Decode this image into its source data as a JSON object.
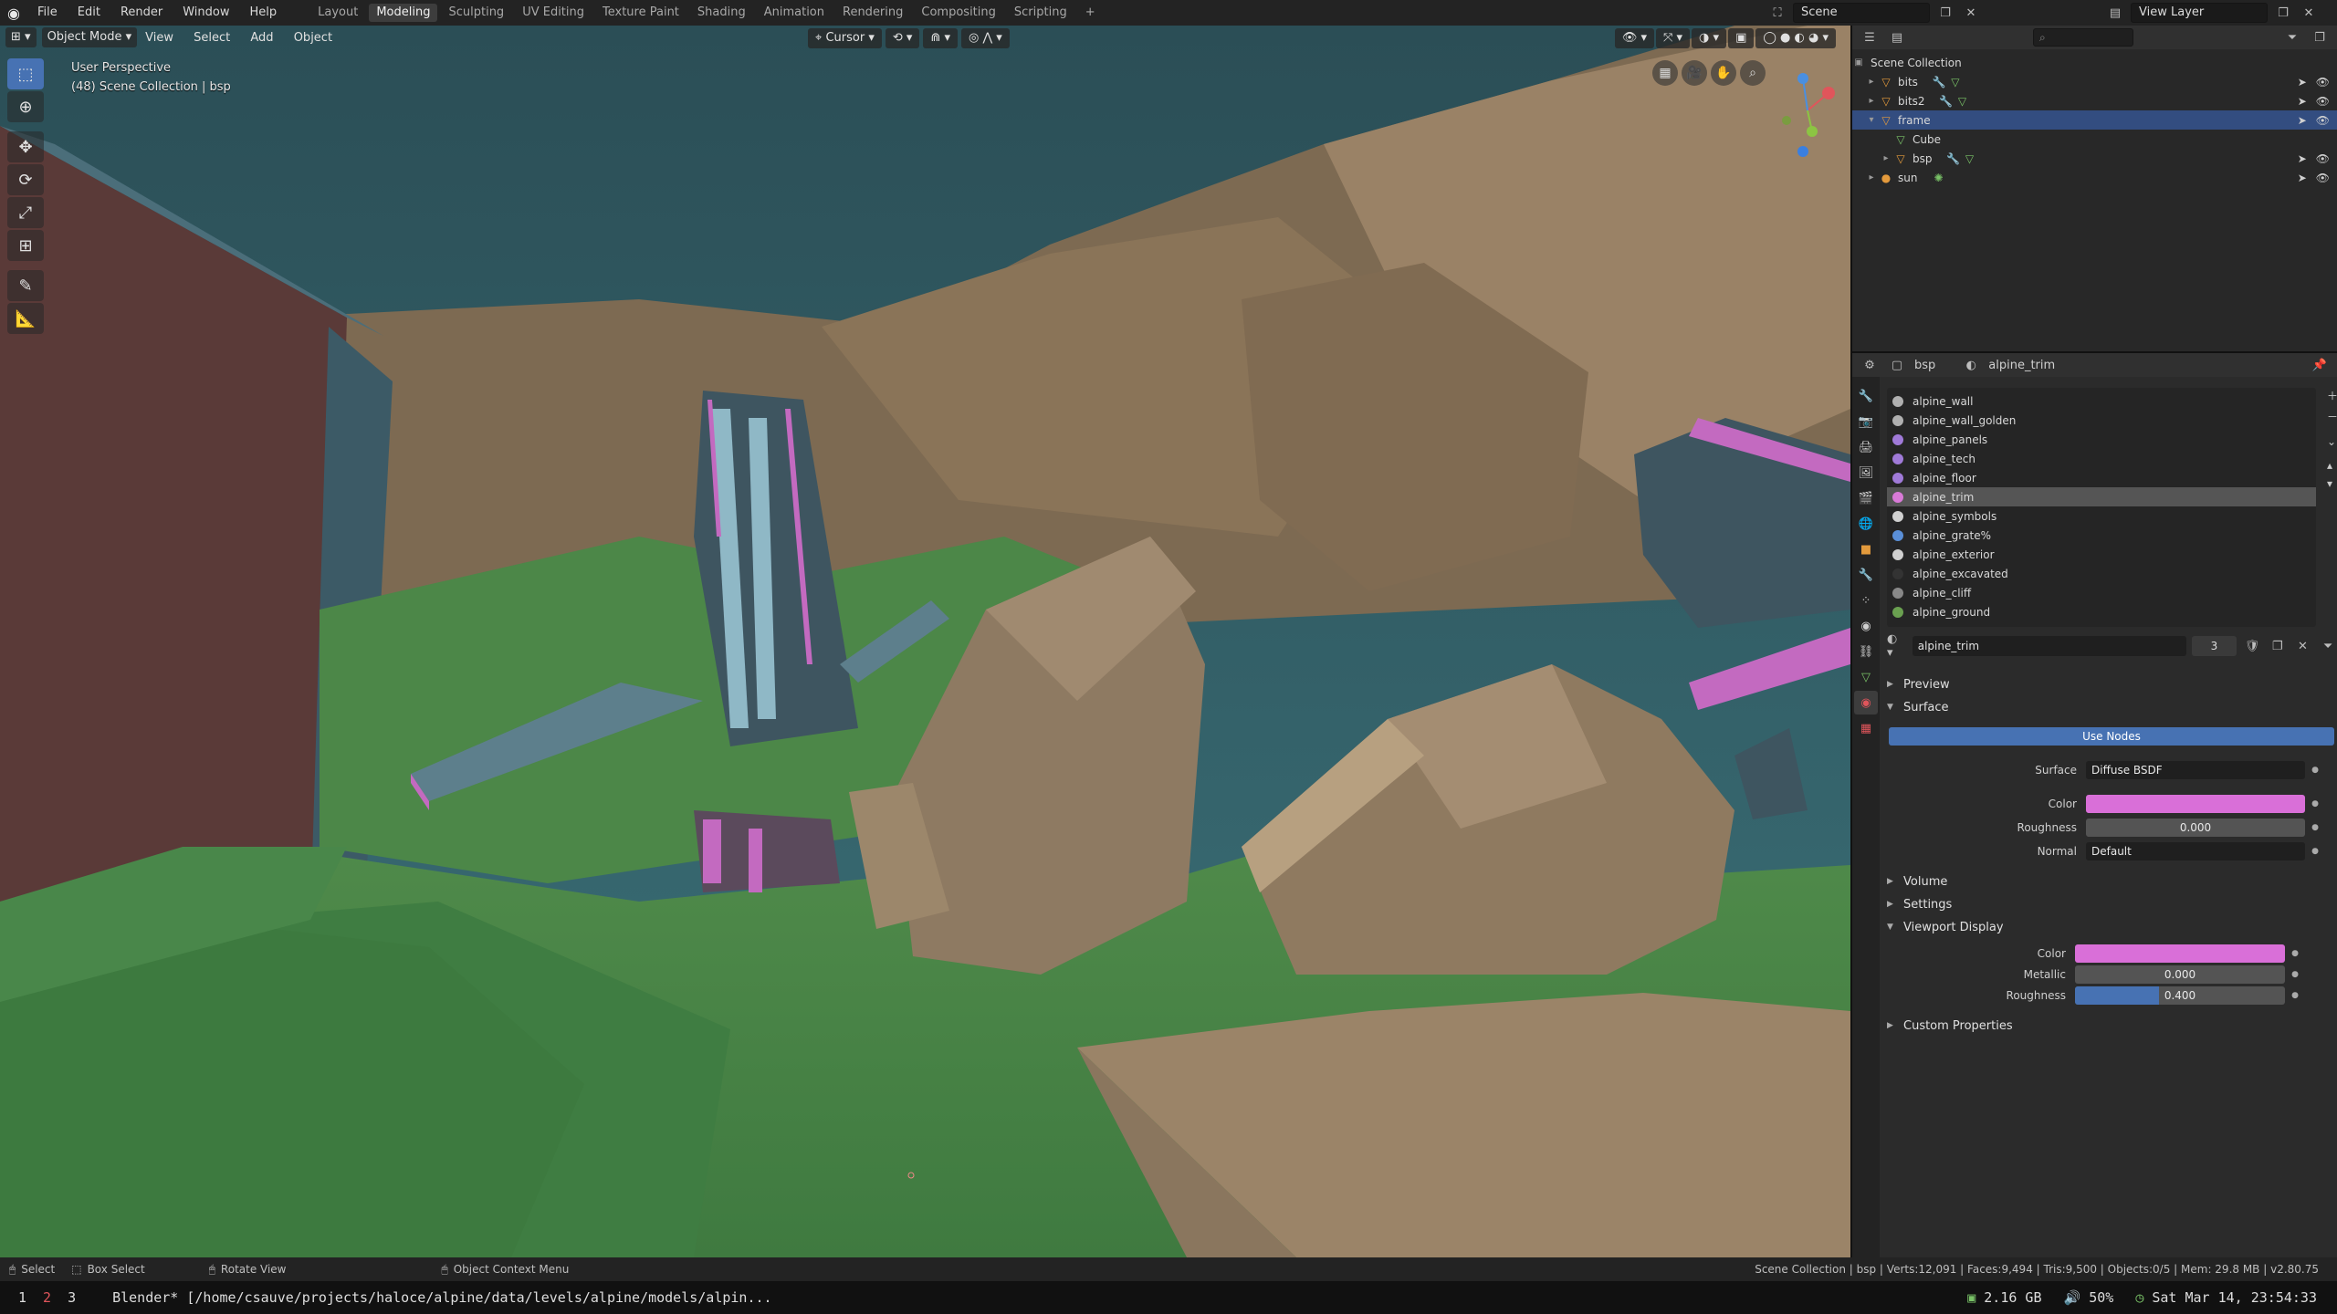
{
  "topbar": {
    "menus": [
      "File",
      "Edit",
      "Render",
      "Window",
      "Help"
    ],
    "workspaces": [
      "Layout",
      "Modeling",
      "Sculpting",
      "UV Editing",
      "Texture Paint",
      "Shading",
      "Animation",
      "Rendering",
      "Compositing",
      "Scripting"
    ],
    "active_workspace": "Modeling",
    "add_tab": "+",
    "scene": "Scene",
    "view_layer": "View Layer"
  },
  "viewport": {
    "mode": "Object Mode",
    "menus": [
      "View",
      "Select",
      "Add",
      "Object"
    ],
    "transform_orientation": "Cursor",
    "overlay_title": "User Perspective",
    "overlay_collection": "(48) Scene Collection | bsp"
  },
  "outliner": {
    "root": "Scene Collection",
    "items": [
      {
        "name": "bits",
        "selected": false
      },
      {
        "name": "bits2",
        "selected": false
      },
      {
        "name": "frame",
        "selected": true
      },
      {
        "name": "Cube",
        "selected": false
      },
      {
        "name": "bsp",
        "selected": false
      },
      {
        "name": "sun",
        "selected": false
      }
    ]
  },
  "properties": {
    "object": "bsp",
    "material": "alpine_trim",
    "materials": [
      {
        "name": "alpine_wall",
        "color": "#b0b0b0"
      },
      {
        "name": "alpine_wall_golden",
        "color": "#b0b0b0"
      },
      {
        "name": "alpine_panels",
        "color": "#a07ad8"
      },
      {
        "name": "alpine_tech",
        "color": "#a07ad8"
      },
      {
        "name": "alpine_floor",
        "color": "#a07ad8"
      },
      {
        "name": "alpine_trim",
        "color": "#d97ad8"
      },
      {
        "name": "alpine_symbols",
        "color": "#d0d0d0"
      },
      {
        "name": "alpine_grate%",
        "color": "#5a8fd8"
      },
      {
        "name": "alpine_exterior",
        "color": "#d0d0d0"
      },
      {
        "name": "alpine_excavated",
        "color": "#333333"
      },
      {
        "name": "alpine_cliff",
        "color": "#888888"
      },
      {
        "name": "alpine_ground",
        "color": "#6aa050"
      }
    ],
    "selected_material_index": 5,
    "slot_name": "alpine_trim",
    "users": "3",
    "panels": {
      "preview": "Preview",
      "surface": "Surface",
      "use_nodes": "Use Nodes",
      "volume": "Volume",
      "settings": "Settings",
      "viewport_display": "Viewport Display",
      "custom_properties": "Custom Properties"
    },
    "surface": {
      "surface_label": "Surface",
      "surface_value": "Diffuse BSDF",
      "color_label": "Color",
      "color": "#d96fd8",
      "roughness_label": "Roughness",
      "roughness": "0.000",
      "normal_label": "Normal",
      "normal": "Default"
    },
    "viewport_display": {
      "color_label": "Color",
      "color": "#d96fd8",
      "metallic_label": "Metallic",
      "metallic": "0.000",
      "metallic_fraction": 0.0,
      "roughness_label": "Roughness",
      "roughness": "0.400",
      "roughness_fraction": 0.4
    }
  },
  "statusbar": {
    "select": "Select",
    "box_select": "Box Select",
    "rotate": "Rotate View",
    "context": "Object Context Menu",
    "stats": "Scene Collection | bsp | Verts:12,091 | Faces:9,494 | Tris:9,500 | Objects:0/5 | Mem: 29.8 MB | v2.80.75"
  },
  "taskbar": {
    "workspaces": [
      "1",
      "2",
      "3"
    ],
    "active": "2",
    "title": "Blender* [/home/csauve/projects/haloce/alpine/data/levels/alpine/models/alpin...",
    "memory": "2.16 GB",
    "volume": "50%",
    "datetime": "Sat Mar 14, 23:54:33"
  }
}
